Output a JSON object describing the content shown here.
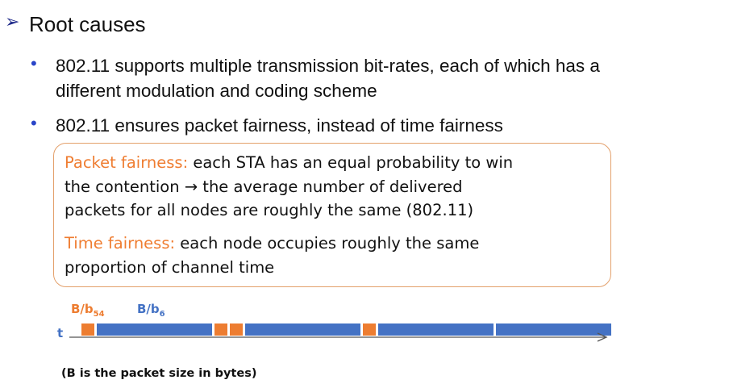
{
  "heading": {
    "arrow": "➢",
    "title": "Root causes"
  },
  "bullets": [
    {
      "dot": "•",
      "line1": "802.11 supports multiple transmission bit-rates, each of which has a",
      "line2": "different modulation and coding scheme"
    },
    {
      "dot": "•",
      "line1": "802.11 ensures packet fairness, instead of time fairness"
    }
  ],
  "definitions": {
    "packet": {
      "term": "Packet fairness:",
      "line1_rest": " each STA has an equal probability to win",
      "line2": "the contention → the average number of delivered",
      "line3": "packets for all nodes are roughly the same (802.11)"
    },
    "time": {
      "term": "Time fairness:",
      "line1_rest": " each node occupies roughly the same",
      "line2": "proportion of channel time"
    }
  },
  "timeline": {
    "axis_label": "t",
    "label_fast": {
      "base": "B/b",
      "sub": "54"
    },
    "label_slow": {
      "base": "B/b",
      "sub": "6"
    },
    "colors": {
      "fast": "#ed7d31",
      "slow": "#4472c4",
      "axis": "#555555"
    },
    "sequence": [
      "fast",
      "slow",
      "fast",
      "fast",
      "slow",
      "fast",
      "slow",
      "slow"
    ]
  },
  "note": "(B is the packet size in bytes)"
}
